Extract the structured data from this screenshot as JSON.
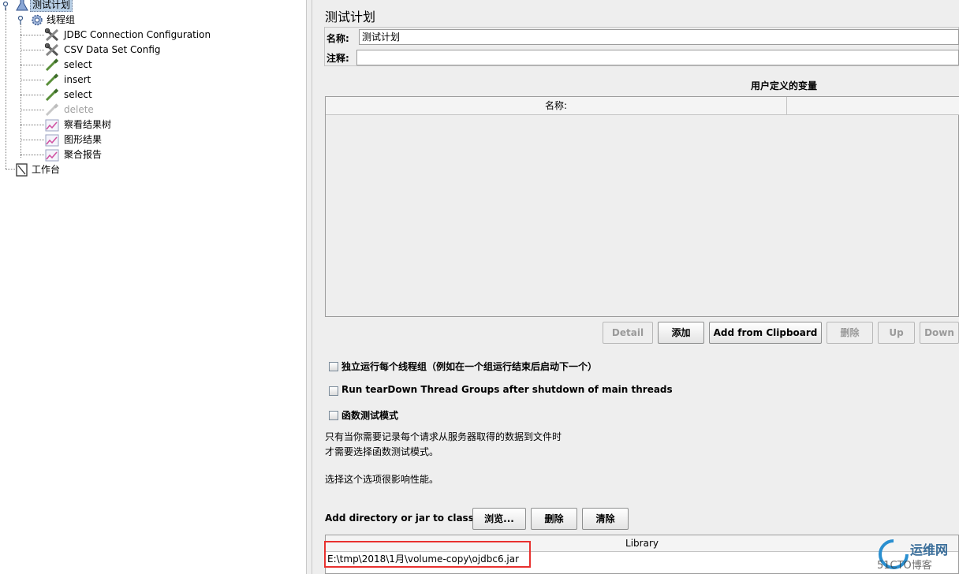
{
  "tree": {
    "root_label": "测试计划",
    "thread_group_label": "线程组",
    "children": [
      {
        "label": "JDBC Connection Configuration",
        "icon": "wrench-icon",
        "enabled": true
      },
      {
        "label": "CSV Data Set Config",
        "icon": "wrench-icon",
        "enabled": true
      },
      {
        "label": "select",
        "icon": "pipette-icon",
        "enabled": true
      },
      {
        "label": "insert",
        "icon": "pipette-icon",
        "enabled": true
      },
      {
        "label": "select",
        "icon": "pipette-icon",
        "enabled": true
      },
      {
        "label": "delete",
        "icon": "pipette-icon",
        "enabled": false
      },
      {
        "label": "察看结果树",
        "icon": "chart-icon",
        "enabled": true
      },
      {
        "label": "图形结果",
        "icon": "chart-icon",
        "enabled": true
      },
      {
        "label": "聚合报告",
        "icon": "chart-icon",
        "enabled": true
      }
    ],
    "workbench_label": "工作台"
  },
  "panel": {
    "title": "测试计划",
    "name_label": "名称:",
    "name_value": "测试计划",
    "comment_label": "注释:",
    "comment_value": "",
    "vars_title": "用户定义的变量",
    "vars_col_name": "名称:",
    "buttons": {
      "detail": "Detail",
      "add": "添加",
      "add_clipboard": "Add from Clipboard",
      "delete": "删除",
      "up": "Up",
      "down": "Down"
    },
    "checkboxes": {
      "serialize": "独立运行每个线程组（例如在一个组运行结束后启动下一个）",
      "teardown": "Run tearDown Thread Groups after shutdown of main threads",
      "functional": "函数测试模式"
    },
    "functional_note_1": "只有当你需要记录每个请求从服务器取得的数据到文件时",
    "functional_note_2": "才需要选择函数测试模式。",
    "functional_note_3": "选择这个选项很影响性能。",
    "classpath_label": "Add directory or jar to classpath",
    "classpath_buttons": {
      "browse": "浏览...",
      "delete": "删除",
      "clear": "清除"
    },
    "library_header": "Library",
    "library_row": "E:\\tmp\\2018\\1月\\volume-copy\\ojdbc6.jar"
  },
  "watermark": {
    "text": "运维网",
    "sub": "51CTO博客"
  },
  "colors": {
    "selection": "#b8cfe5",
    "highlight_box": "#e8312f",
    "panel_bg": "#eeeeee"
  }
}
